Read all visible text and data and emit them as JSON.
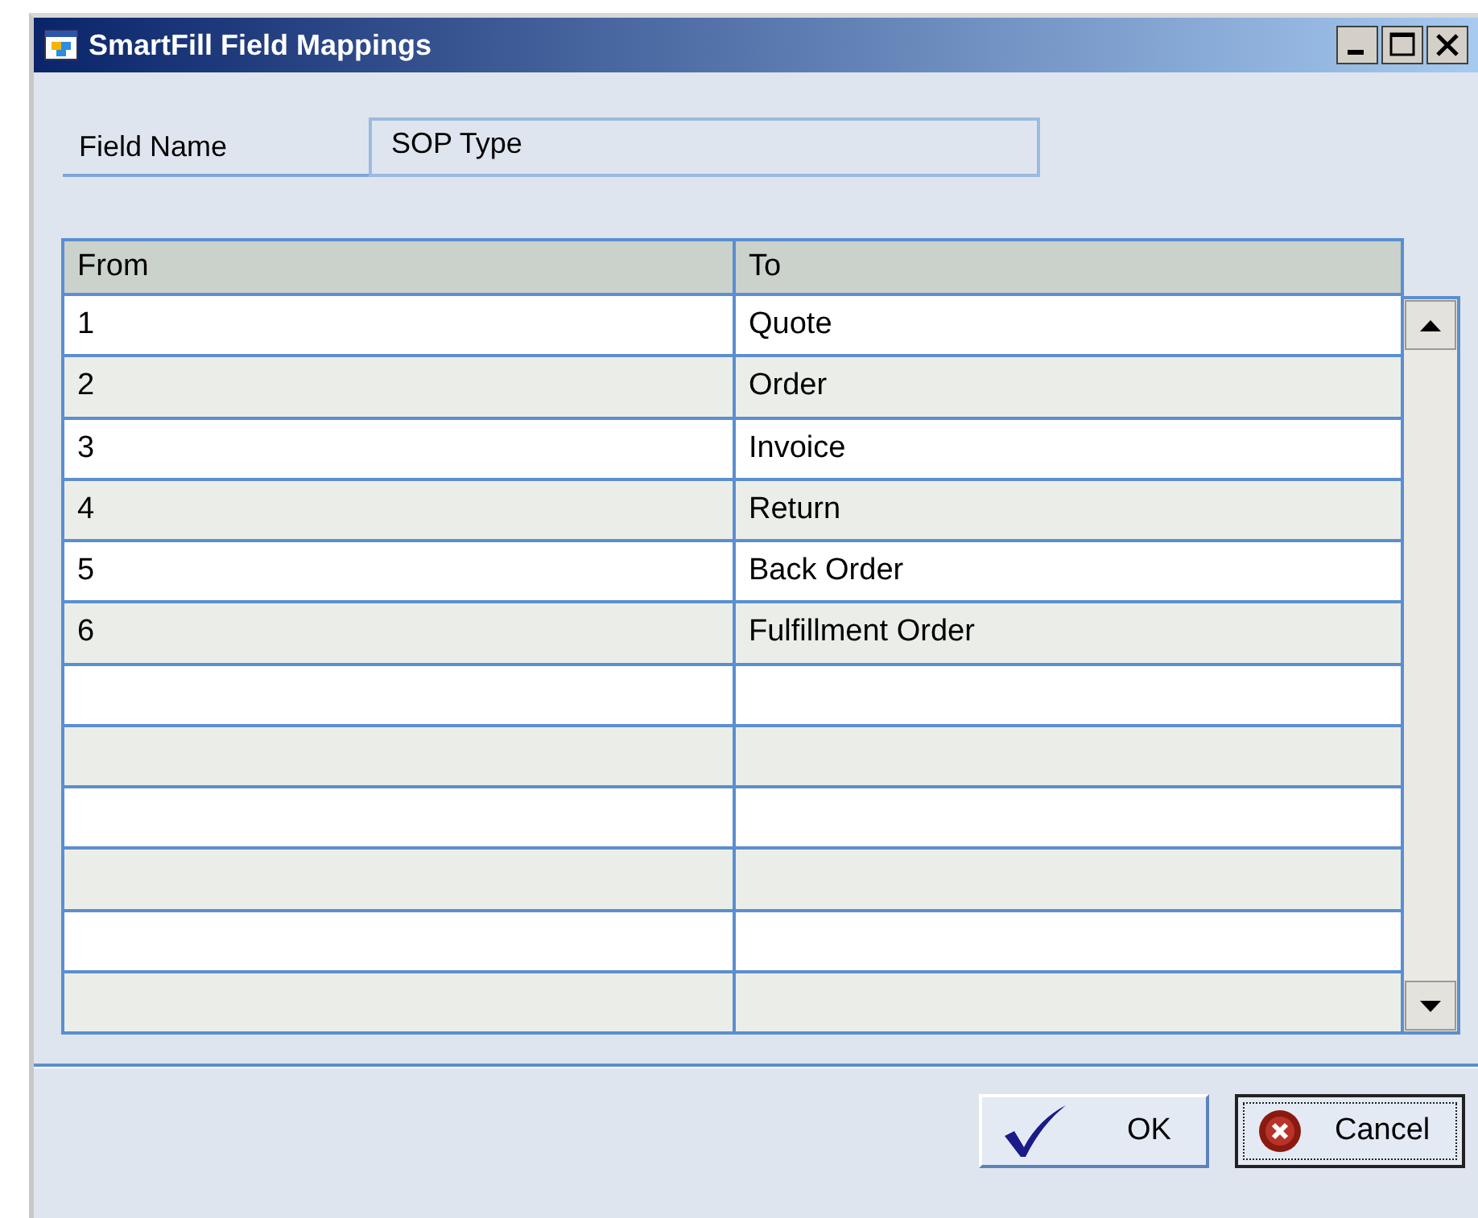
{
  "window": {
    "title": "SmartFill Field Mappings"
  },
  "field": {
    "label": "Field Name",
    "value": "SOP Type"
  },
  "table": {
    "columns": [
      "From",
      "To"
    ],
    "rows": [
      [
        "1",
        "Quote"
      ],
      [
        "2",
        "Order"
      ],
      [
        "3",
        "Invoice"
      ],
      [
        "4",
        "Return"
      ],
      [
        "5",
        "Back Order"
      ],
      [
        "6",
        "Fulfillment Order"
      ]
    ]
  },
  "buttons": [
    {
      "label": "OK",
      "kind": "ok",
      "focused": false
    },
    {
      "label": "Cancel",
      "kind": "cancel",
      "focused": true
    }
  ]
}
